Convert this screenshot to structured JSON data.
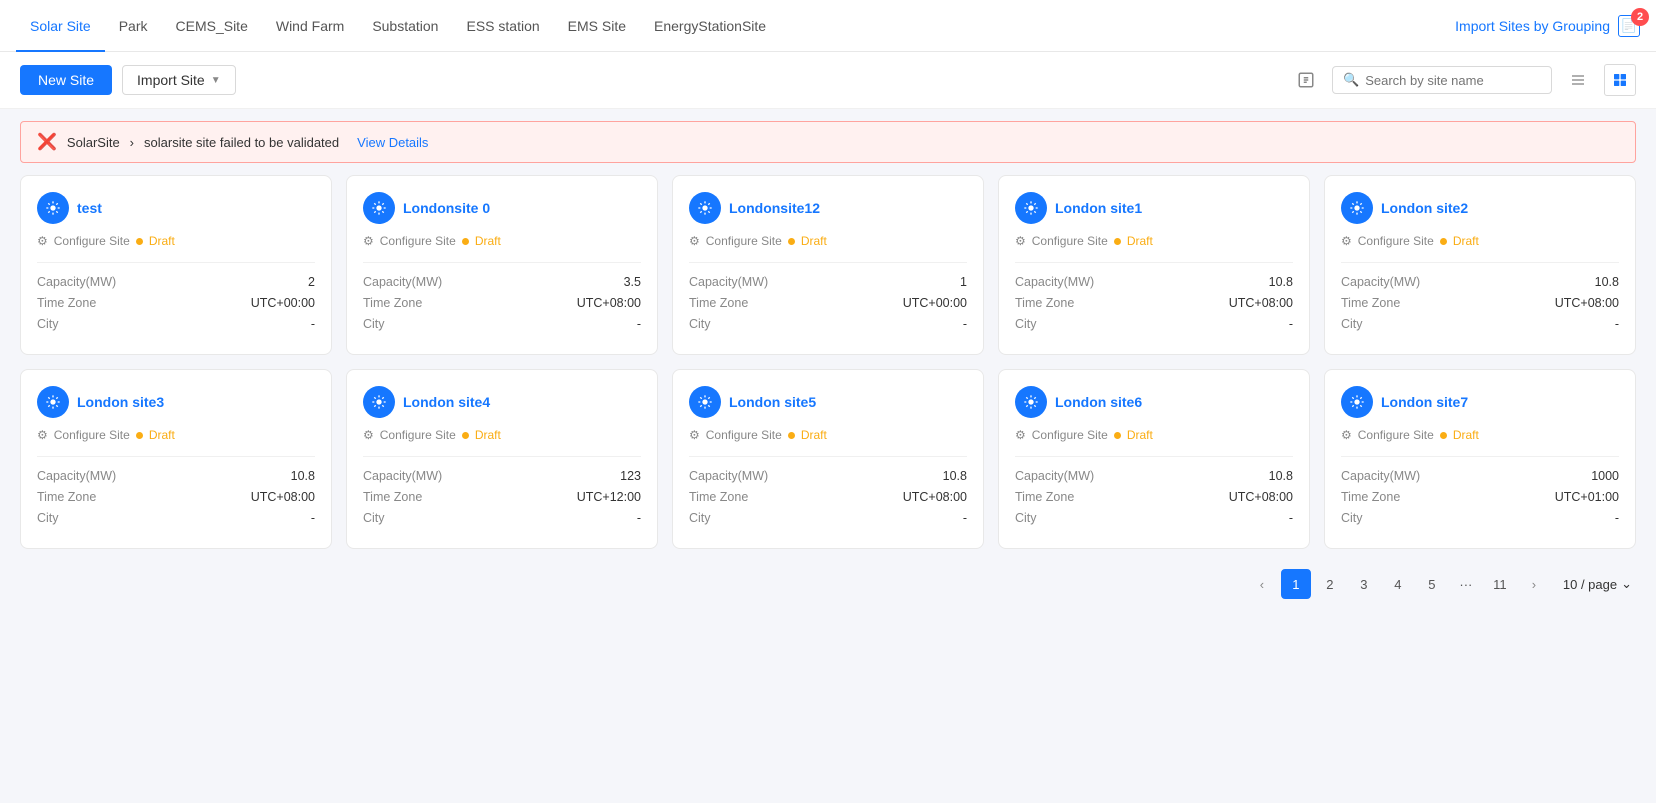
{
  "tabs": [
    {
      "id": "solar-site",
      "label": "Solar Site",
      "active": true
    },
    {
      "id": "park",
      "label": "Park",
      "active": false
    },
    {
      "id": "cems-site",
      "label": "CEMS_Site",
      "active": false
    },
    {
      "id": "wind-farm",
      "label": "Wind Farm",
      "active": false
    },
    {
      "id": "substation",
      "label": "Substation",
      "active": false
    },
    {
      "id": "ess-station",
      "label": "ESS station",
      "active": false
    },
    {
      "id": "ems-site",
      "label": "EMS Site",
      "active": false
    },
    {
      "id": "energy-station-site",
      "label": "EnergyStationSite",
      "active": false
    }
  ],
  "import_grouping": {
    "label": "Import Sites by Grouping",
    "badge": "2"
  },
  "toolbar": {
    "new_site_label": "New Site",
    "import_label": "Import Site",
    "search_placeholder": "Search by site name"
  },
  "error_banner": {
    "prefix": "SolarSite",
    "separator": "›",
    "message": "solarsite site failed to be validated",
    "link_label": "View Details"
  },
  "sites": [
    {
      "name": "test",
      "status": "Draft",
      "capacity": "2",
      "timezone": "UTC+00:00",
      "city": "-"
    },
    {
      "name": "Londonsite 0",
      "status": "Draft",
      "capacity": "3.5",
      "timezone": "UTC+08:00",
      "city": "-"
    },
    {
      "name": "Londonsite12",
      "status": "Draft",
      "capacity": "1",
      "timezone": "UTC+00:00",
      "city": "-"
    },
    {
      "name": "London site1",
      "status": "Draft",
      "capacity": "10.8",
      "timezone": "UTC+08:00",
      "city": "-"
    },
    {
      "name": "London site2",
      "status": "Draft",
      "capacity": "10.8",
      "timezone": "UTC+08:00",
      "city": "-"
    },
    {
      "name": "London site3",
      "status": "Draft",
      "capacity": "10.8",
      "timezone": "UTC+08:00",
      "city": "-"
    },
    {
      "name": "London site4",
      "status": "Draft",
      "capacity": "123",
      "timezone": "UTC+12:00",
      "city": "-"
    },
    {
      "name": "London site5",
      "status": "Draft",
      "capacity": "10.8",
      "timezone": "UTC+08:00",
      "city": "-"
    },
    {
      "name": "London site6",
      "status": "Draft",
      "capacity": "10.8",
      "timezone": "UTC+08:00",
      "city": "-"
    },
    {
      "name": "London site7",
      "status": "Draft",
      "capacity": "1000",
      "timezone": "UTC+01:00",
      "city": "-"
    }
  ],
  "card_labels": {
    "capacity": "Capacity(MW)",
    "timezone": "Time Zone",
    "city": "City",
    "configure": "Configure Site"
  },
  "pagination": {
    "pages": [
      "1",
      "2",
      "3",
      "4",
      "5"
    ],
    "ellipsis": "···",
    "last_page": "11",
    "current": "1",
    "page_size": "10 / page"
  }
}
